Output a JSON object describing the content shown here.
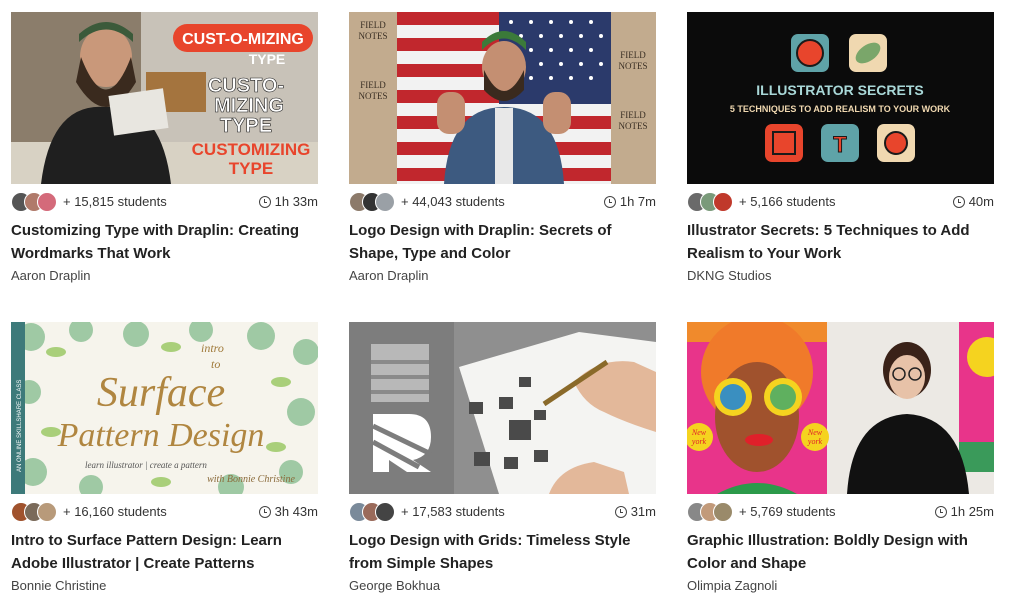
{
  "courses": [
    {
      "title": "Customizing Type with Draplin: Creating Wordmarks That Work",
      "author": "Aaron Draplin",
      "students": "+ 15,815 students",
      "duration": "1h 33m",
      "thumb_text": [
        "CUST-O-MIZING",
        "TYPE",
        "CUSTO-",
        "MIZING",
        "TYPE",
        "CUSTOMIZING",
        "TYPE"
      ],
      "colors": {
        "accent": "#e8452c"
      }
    },
    {
      "title": "Logo Design with Draplin: Secrets of Shape, Type and Color",
      "author": "Aaron Draplin",
      "students": "+ 44,043 students",
      "duration": "1h 7m",
      "thumb_text": [
        "FIELD",
        "NOTES",
        "FIELD",
        "NOTES",
        "FIELD",
        "NOTES",
        "FIELD",
        "NOTES"
      ]
    },
    {
      "title": "Illustrator Secrets: 5 Techniques to Add Realism to Your Work",
      "author": "DKNG Studios",
      "students": "+ 5,166 students",
      "duration": "40m",
      "thumb_text": [
        "ILLUSTRATOR SECRETS",
        "5 TECHNIQUES TO ADD REALISM TO YOUR WORK"
      ]
    },
    {
      "title": "Intro to Surface Pattern Design: Learn Adobe Illustrator | Create Patterns",
      "author": "Bonnie Christine",
      "students": "+ 16,160 students",
      "duration": "3h 43m",
      "thumb_text": [
        "intro",
        "to",
        "Surface",
        "Pattern Design",
        "learn illustrator | create a pattern",
        "with Bonnie Christine",
        "AN ONLINE SKILLSHARE CLASS"
      ]
    },
    {
      "title": "Logo Design with Grids: Timeless Style from Simple Shapes",
      "author": "George Bokhua",
      "students": "+ 17,583 students",
      "duration": "31m"
    },
    {
      "title": "Graphic Illustration: Boldly Design with Color and Shape",
      "author": "Olimpia Zagnoli",
      "students": "+ 5,769 students",
      "duration": "1h 25m",
      "thumb_text": [
        "New",
        "york",
        "New",
        "york"
      ]
    }
  ]
}
